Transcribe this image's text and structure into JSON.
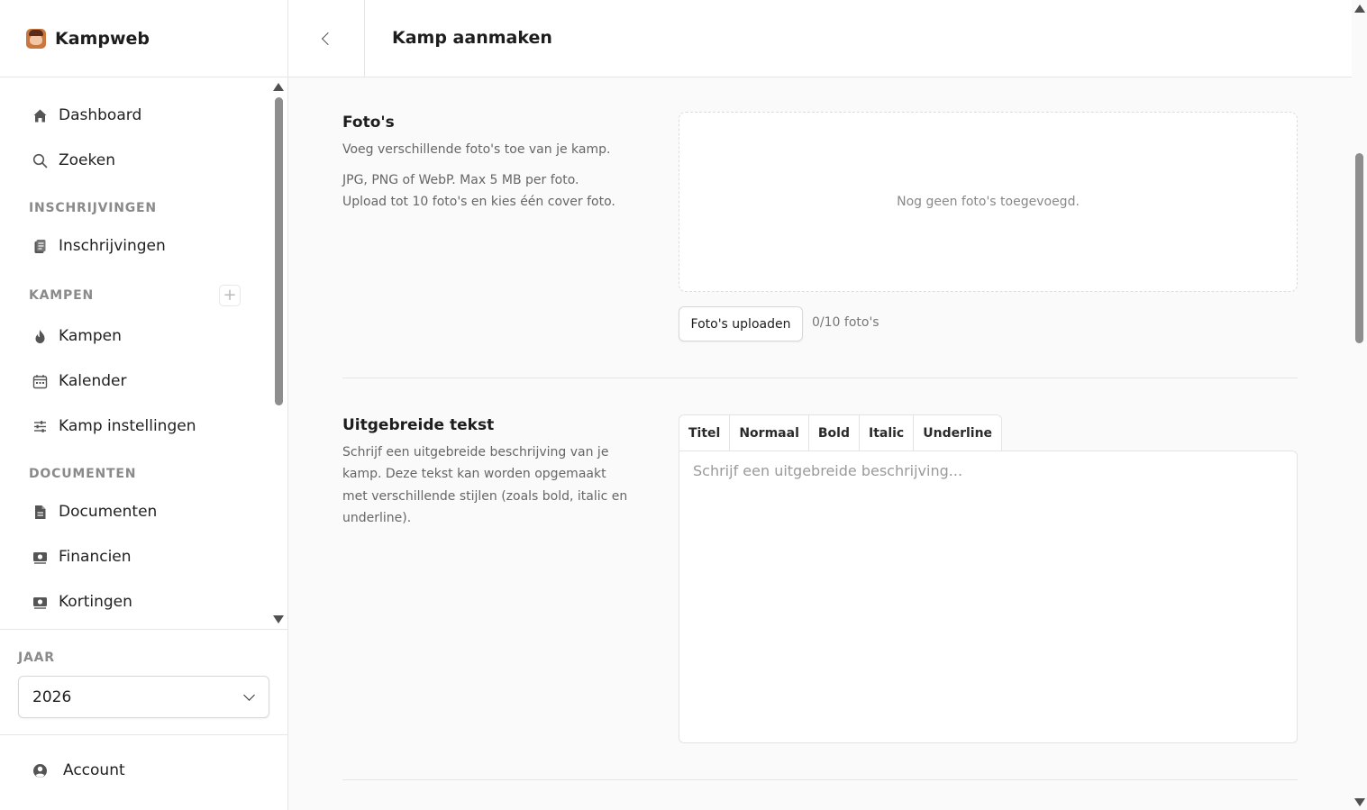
{
  "app": {
    "name": "Kampweb"
  },
  "sidebar": {
    "items": {
      "dashboard": "Dashboard",
      "zoeken": "Zoeken",
      "inschrijvingen": "Inschrijvingen",
      "kampen": "Kampen",
      "kalender": "Kalender",
      "kamp_instellingen": "Kamp instellingen",
      "documenten": "Documenten",
      "financien": "Financien",
      "kortingen": "Kortingen"
    },
    "sections": {
      "inschrijvingen": "INSCHRIJVINGEN",
      "kampen": "KAMPEN",
      "documenten": "DOCUMENTEN"
    },
    "add_label": "+",
    "year": {
      "label": "JAAR",
      "value": "2026"
    },
    "account": "Account"
  },
  "header": {
    "title": "Kamp aanmaken"
  },
  "photos": {
    "title": "Foto's",
    "desc": "Voeg verschillende foto's toe van je kamp.",
    "hint_1": "JPG, PNG of WebP. Max 5 MB per foto.",
    "hint_2": "Upload tot 10 foto's en kies één cover foto.",
    "empty": "Nog geen foto's toegevoegd.",
    "upload_label": "Foto's uploaden",
    "count": "0/10 foto's"
  },
  "text": {
    "title": "Uitgebreide tekst",
    "desc_lines": [
      "Schrijf een uitgebreide beschrijving van je",
      "kamp. Deze tekst kan worden opgemaakt",
      "met verschillende stijlen (zoals bold, italic en",
      "underline)."
    ],
    "toolbar": [
      "Titel",
      "Normaal",
      "Bold",
      "Italic",
      "Underline"
    ],
    "placeholder": "Schrijf een uitgebreide beschrijving..."
  }
}
